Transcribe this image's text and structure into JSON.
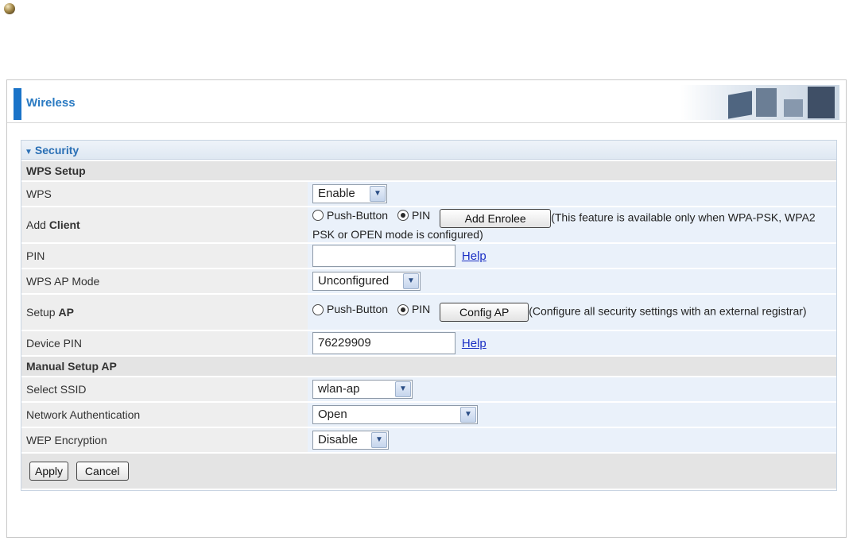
{
  "header": {
    "title": "Wireless"
  },
  "section": {
    "title": "Security"
  },
  "wps_setup": {
    "group_title": "WPS Setup",
    "wps": {
      "label": "WPS",
      "value": "Enable"
    },
    "add_client": {
      "label_prefix": "Add ",
      "label_bold": "Client",
      "radio_push": "Push-Button",
      "radio_pin": "PIN",
      "selected": "PIN",
      "button": "Add Enrolee",
      "note": "(This feature is available only when WPA-PSK, WPA2 PSK or OPEN mode is configured)"
    },
    "pin": {
      "label": "PIN",
      "value": "",
      "help": "Help"
    },
    "ap_mode": {
      "label": "WPS AP Mode",
      "value": "Unconfigured"
    },
    "setup_ap": {
      "label_prefix": "Setup ",
      "label_bold": "AP",
      "radio_push": "Push-Button",
      "radio_pin": "PIN",
      "selected": "PIN",
      "button": "Config AP",
      "note": "(Configure all security settings with an external registrar)"
    },
    "device_pin": {
      "label": "Device PIN",
      "value": "76229909",
      "help": "Help"
    }
  },
  "manual_setup": {
    "group_title": "Manual Setup AP",
    "ssid": {
      "label": "Select SSID",
      "value": "wlan-ap"
    },
    "auth": {
      "label": "Network Authentication",
      "value": "Open"
    },
    "wep": {
      "label": "WEP Encryption",
      "value": "Disable"
    }
  },
  "actions": {
    "apply": "Apply",
    "cancel": "Cancel"
  },
  "icons": {
    "dropdown": "chevron-down-icon",
    "section_toggle": "triangle-down-icon"
  },
  "colors": {
    "accent": "#1a73c8",
    "title": "#2a7ac2",
    "link": "#1a2fc4"
  }
}
